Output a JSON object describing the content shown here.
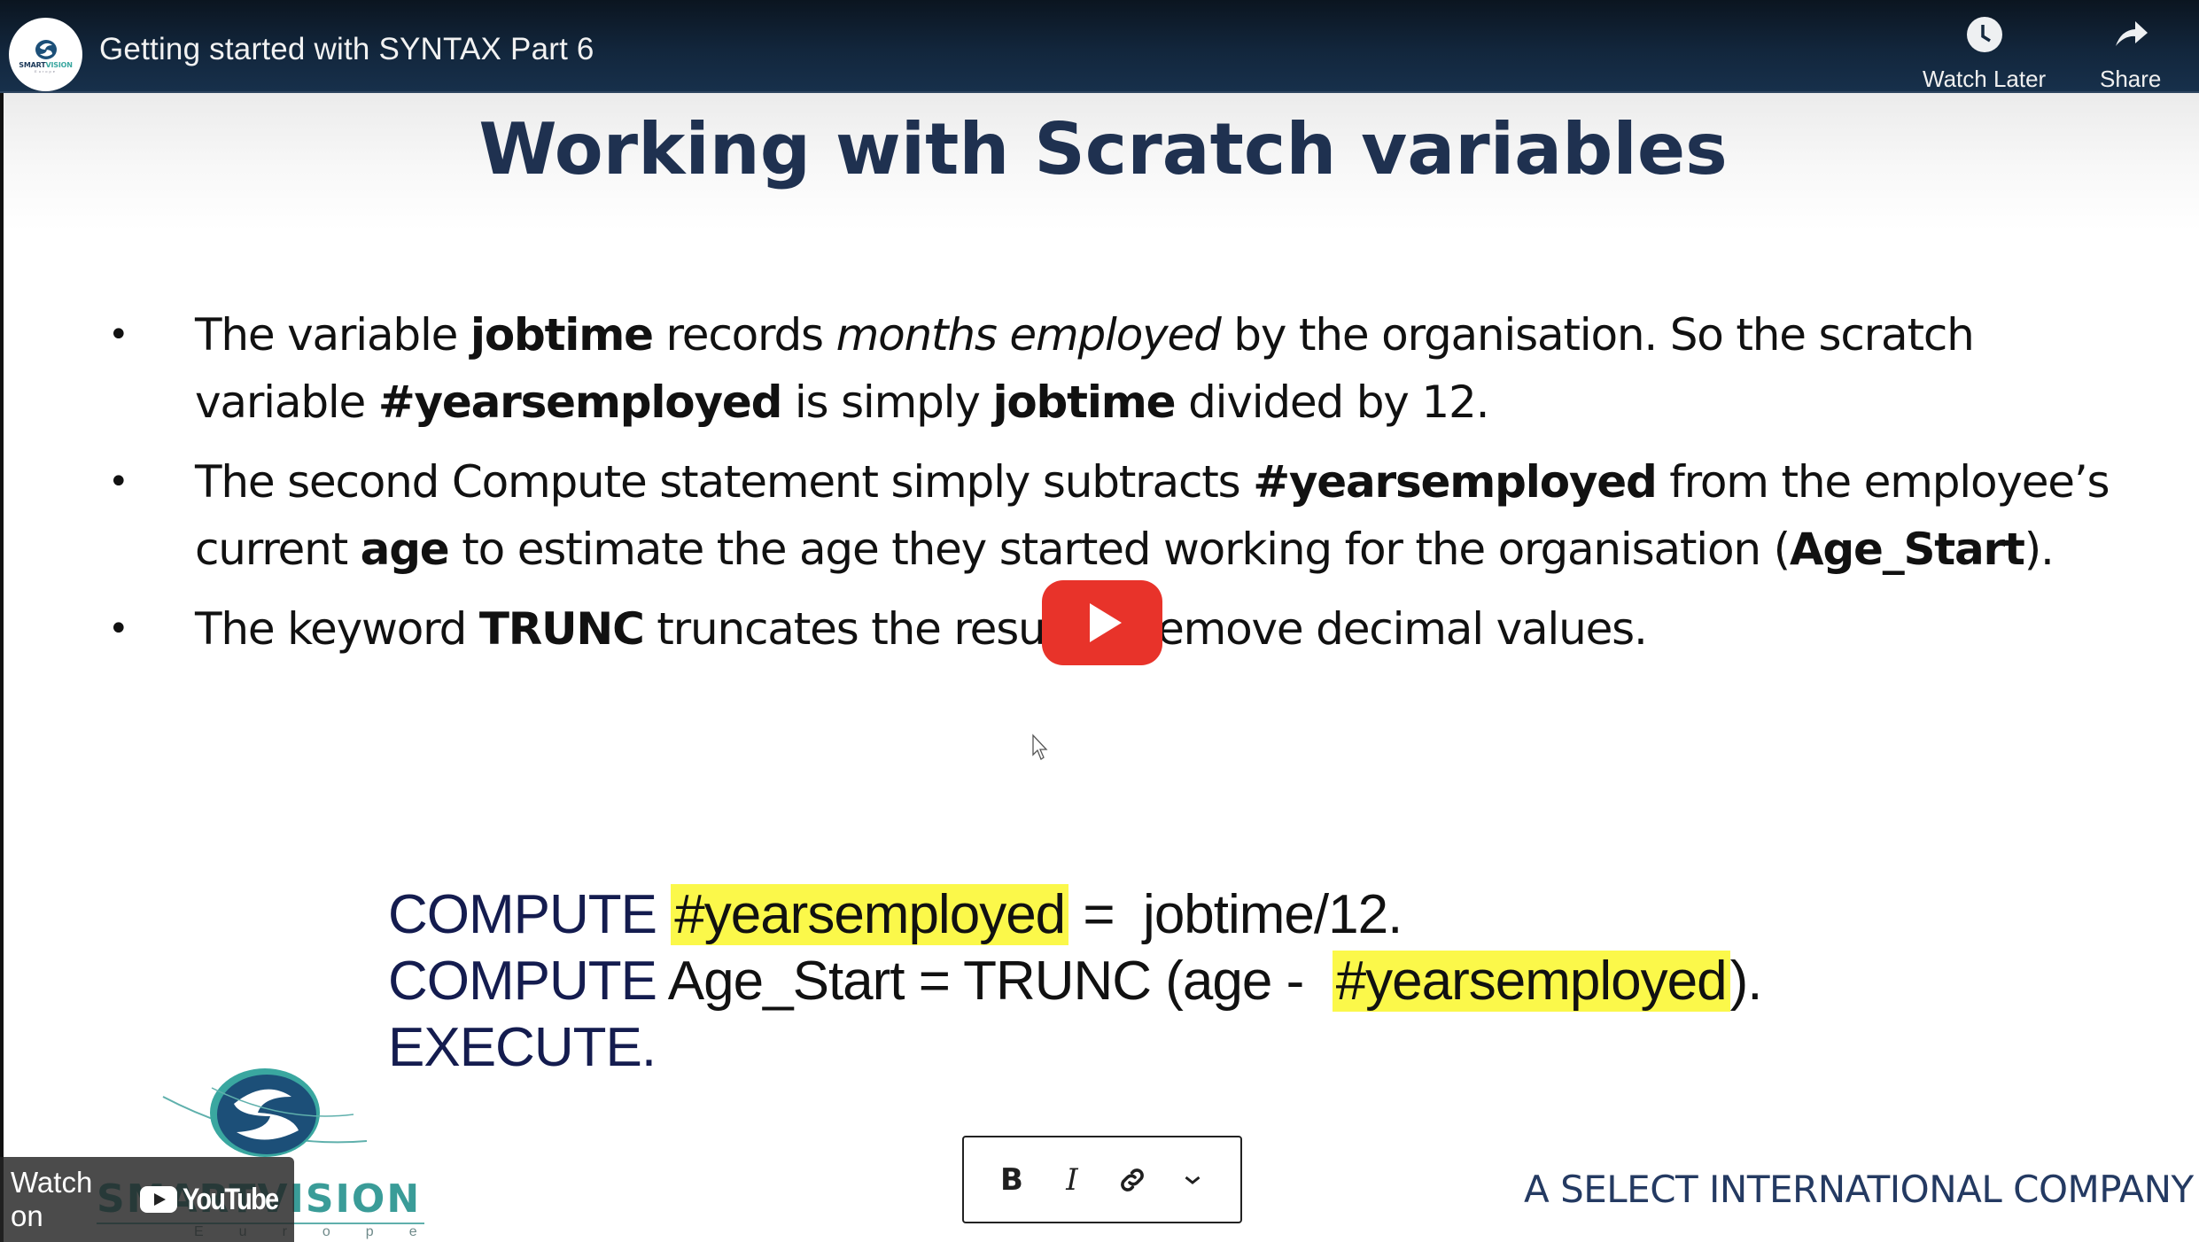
{
  "header": {
    "channel_logo_alt": "SMARTVISION Europe",
    "channel_logo_brand_a": "SMART",
    "channel_logo_brand_b": "VISION",
    "channel_logo_sub": "Europe",
    "video_title": "Getting started with SYNTAX Part 6",
    "actions": [
      {
        "label": "Watch Later",
        "icon": "clock-icon"
      },
      {
        "label": "Share",
        "icon": "share-arrow-icon"
      }
    ]
  },
  "slide": {
    "title": "Working with Scratch variables",
    "bullets": [
      {
        "parts": [
          {
            "t": "The variable ",
            "s": "n"
          },
          {
            "t": "jobtime",
            "s": "b"
          },
          {
            "t": " records ",
            "s": "n"
          },
          {
            "t": "months employed",
            "s": "i"
          },
          {
            "t": " by the organisation. So the scratch variable ",
            "s": "n"
          },
          {
            "t": "#yearsemployed",
            "s": "b"
          },
          {
            "t": " is simply ",
            "s": "n"
          },
          {
            "t": "jobtime",
            "s": "b"
          },
          {
            "t": " divided by 12.",
            "s": "n"
          }
        ]
      },
      {
        "parts": [
          {
            "t": "The second Compute statement simply subtracts ",
            "s": "n"
          },
          {
            "t": "#yearsemployed",
            "s": "b"
          },
          {
            "t": " from the employee’s current ",
            "s": "n"
          },
          {
            "t": "age",
            "s": "b"
          },
          {
            "t": " to estimate the age they started working for the organisation (",
            "s": "n"
          },
          {
            "t": "Age_Start",
            "s": "b"
          },
          {
            "t": ").",
            "s": "n"
          }
        ]
      },
      {
        "parts": [
          {
            "t": "The keyword ",
            "s": "n"
          },
          {
            "t": "TRUNC",
            "s": "b"
          },
          {
            "t": " truncates the result to remove decimal values.",
            "s": "n"
          }
        ]
      }
    ],
    "code_lines": [
      [
        {
          "t": "COMPUTE",
          "s": "kw"
        },
        {
          "t": " ",
          "s": "n"
        },
        {
          "t": "#yearsemployed",
          "s": "hl"
        },
        {
          "t": " =  jobtime/12.",
          "s": "n"
        }
      ],
      [
        {
          "t": "COMPUTE",
          "s": "kw"
        },
        {
          "t": " Age_Start = TRUNC (age -  ",
          "s": "n"
        },
        {
          "t": "#yearsemployed",
          "s": "hl"
        },
        {
          "t": ").",
          "s": "n"
        }
      ],
      [
        {
          "t": "EXECUTE.",
          "s": "kw"
        }
      ]
    ],
    "logo_wordmark": "SMARTVISION",
    "logo_sub": "Europe",
    "company_tagline": "A SELECT INTERNATIONAL COMPANY"
  },
  "player": {
    "watch_on_label": "Watch on",
    "youtube_wordmark": "YouTube",
    "play_icon": "youtube-play-icon"
  },
  "format_toolbar": {
    "bold_label": "B",
    "italic_label": "I",
    "link_icon": "link-icon",
    "more_icon": "chevron-down-icon"
  },
  "colors": {
    "header_bg": "#12263c",
    "title_color": "#1f3150",
    "highlight": "#fbf84a",
    "play_red": "#e8332a",
    "code_keyword": "#141c4f"
  }
}
